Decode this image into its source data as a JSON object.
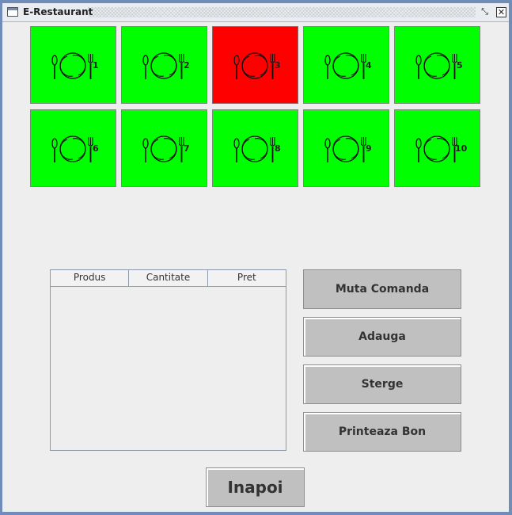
{
  "window": {
    "title": "E-Restaurant",
    "restore_glyph": "⤡",
    "close_glyph": "✕"
  },
  "tables": [
    {
      "number": "1",
      "status": "free"
    },
    {
      "number": "2",
      "status": "free"
    },
    {
      "number": "3",
      "status": "occupied"
    },
    {
      "number": "4",
      "status": "free"
    },
    {
      "number": "5",
      "status": "free"
    },
    {
      "number": "6",
      "status": "free"
    },
    {
      "number": "7",
      "status": "free"
    },
    {
      "number": "8",
      "status": "free"
    },
    {
      "number": "9",
      "status": "free"
    },
    {
      "number": "10",
      "status": "free"
    }
  ],
  "colors": {
    "free": "#00ff00",
    "occupied": "#ff0000"
  },
  "order": {
    "columns": [
      "Produs",
      "Cantitate",
      "Pret"
    ],
    "rows": []
  },
  "actions": {
    "move_order": "Muta Comanda",
    "add": "Adauga",
    "delete": "Sterge",
    "print_receipt": "Printeaza Bon",
    "back": "Inapoi"
  },
  "icons": {
    "table": "plate-cutlery-icon"
  }
}
